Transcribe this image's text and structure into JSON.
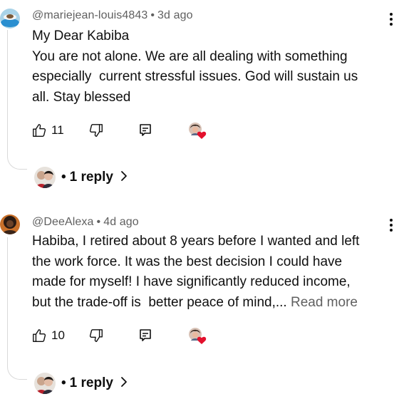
{
  "comments": [
    {
      "author": "@mariejean-louis4843",
      "time": "3d ago",
      "text": "My Dear Kabiba\nYou are not alone. We are all dealing with something\nespecially  current stressful issues. God will sustain us\nall. Stay blessed",
      "likes": "11",
      "replies_label": "1 reply"
    },
    {
      "author": "@DeeAlexa",
      "time": "4d ago",
      "text": "Habiba, I retired about 8 years before I wanted and left\nthe work force. It was the best decision I could have\nmade for myself! I have significantly reduced income,\nbut the trade-off is  better peace of mind,...",
      "read_more": "Read more",
      "likes": "10",
      "replies_label": "1 reply"
    }
  ],
  "separator": "•",
  "icons": {
    "like": "thumb-up-icon",
    "dislike": "thumb-down-icon",
    "reply": "reply-comment-icon",
    "creator_heart": "creator-heart-icon",
    "more": "more-vertical-icon",
    "chevron": "chevron-right-icon"
  },
  "colors": {
    "text": "#0f0f0f",
    "secondary": "#606060",
    "heart": "#e3102c",
    "thread_line": "#d9d9d9"
  }
}
